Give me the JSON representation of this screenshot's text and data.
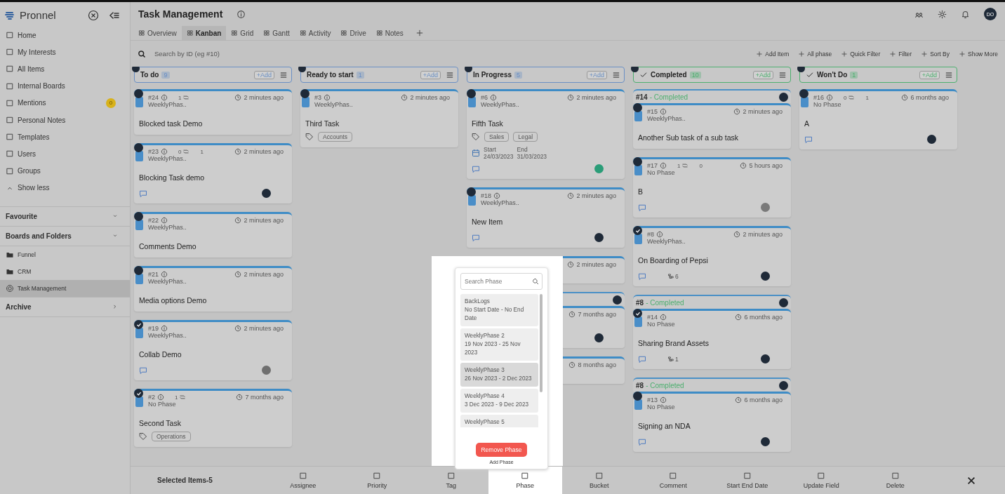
{
  "sidebar": {
    "brand": "Pronnel",
    "nav": [
      {
        "label": "Home"
      },
      {
        "label": "My Interests"
      },
      {
        "label": "All Items"
      },
      {
        "label": "Internal Boards"
      },
      {
        "label": "Mentions",
        "badge": "0"
      },
      {
        "label": "Personal Notes"
      },
      {
        "label": "Templates"
      },
      {
        "label": "Users"
      },
      {
        "label": "Groups"
      }
    ],
    "show_less": "Show less",
    "sections": [
      {
        "label": "Favourite",
        "expanded": true
      },
      {
        "label": "Boards and Folders",
        "expanded": true
      }
    ],
    "boards": [
      {
        "label": "Funnel",
        "kind": "folder",
        "selected": false
      },
      {
        "label": "CRM",
        "kind": "folder",
        "selected": false
      },
      {
        "label": "Task Management",
        "kind": "board",
        "selected": true
      }
    ],
    "archive": "Archive"
  },
  "header": {
    "title": "Task Management",
    "avatar": "DO"
  },
  "tabs": [
    {
      "label": "Overview",
      "selected": false
    },
    {
      "label": "Kanban",
      "selected": true
    },
    {
      "label": "Grid",
      "selected": false
    },
    {
      "label": "Gantt",
      "selected": false
    },
    {
      "label": "Activity",
      "selected": false
    },
    {
      "label": "Drive",
      "selected": false
    },
    {
      "label": "Notes",
      "selected": false
    }
  ],
  "search": {
    "placeholder": "Search by ID (eg #10)"
  },
  "toolbar": [
    "Add Item",
    "All phase",
    "Quick Filter",
    "Filter",
    "Sort By",
    "Show More"
  ],
  "columns": [
    {
      "title": "To do",
      "count": "9",
      "add": "+Add",
      "color": "#6a8fc4",
      "done": false,
      "items": [
        {
          "kind": "card",
          "checked": false,
          "id": "#24",
          "links": [
            "1"
          ],
          "time": "2 minutes ago",
          "phase": "WeeklyPhas..",
          "title": "Blocked task Demo",
          "comment_icon": false
        },
        {
          "kind": "card",
          "checked": false,
          "id": "#23",
          "links": [
            "0",
            "1"
          ],
          "time": "2 minutes ago",
          "phase": "WeeklyPhas..",
          "title": "Blocking Task demo",
          "comment_icon": true,
          "avatar": {
            "color": "#1f2a38"
          }
        },
        {
          "kind": "card",
          "checked": false,
          "id": "#22",
          "time": "2 minutes ago",
          "phase": "WeeklyPhas..",
          "title": "Comments Demo",
          "comment_icon": false
        },
        {
          "kind": "card",
          "checked": false,
          "id": "#21",
          "time": "2 minutes ago",
          "phase": "WeeklyPhas..",
          "title": "Media options Demo",
          "comment_icon": false
        },
        {
          "kind": "card",
          "checked": true,
          "id": "#19",
          "time": "2 minutes ago",
          "phase": "WeeklyPhas..",
          "title": "Collab Demo",
          "comment_icon": true,
          "avatar": {
            "color": "#6f6f6f"
          }
        },
        {
          "kind": "card",
          "checked": true,
          "id": "#2",
          "links": [
            "1"
          ],
          "time": "7 months ago",
          "phase": "No Phase",
          "title": "Second Task",
          "tags": [
            "Operations"
          ],
          "comment_icon": false
        }
      ]
    },
    {
      "title": "Ready to start",
      "count": "1",
      "add": "+Add",
      "color": "#6a8fc4",
      "done": false,
      "items": [
        {
          "kind": "card",
          "checked": false,
          "id": "#3",
          "time": "2 minutes ago",
          "phase": "WeeklyPhas..",
          "title": "Third Task",
          "tags": [
            "Accounts"
          ],
          "comment_icon": false
        }
      ]
    },
    {
      "title": "In Progress",
      "count": "5",
      "add": "+Add",
      "color": "#6a8fc4",
      "done": false,
      "items": [
        {
          "kind": "card",
          "checked": false,
          "id": "#6",
          "time": "2 minutes ago",
          "phase": "WeeklyPhas..",
          "title": "Fifth Task",
          "tags": [
            "Sales",
            "Legal"
          ],
          "dates": {
            "start_label": "Start",
            "start": "24/03/2023",
            "end_label": "End",
            "end": "31/03/2023"
          },
          "comment_icon": true,
          "avatar": {
            "color": "#2a9d78"
          }
        },
        {
          "kind": "card",
          "checked": false,
          "id": "#18",
          "time": "2 minutes ago",
          "phase": "WeeklyPhas..",
          "title": "New Item",
          "comment_icon": true,
          "avatar": {
            "color": "#1f2a38"
          }
        },
        {
          "kind": "card",
          "time": "2 minutes ago",
          "comment_icon": false
        },
        {
          "kind": "parent",
          "avatar": {
            "color": "#1f2a38"
          }
        },
        {
          "kind": "card",
          "time": "7 months ago",
          "comment_icon": false,
          "avatar": {
            "color": "#1f2a38"
          }
        },
        {
          "kind": "card",
          "time": "8 months ago",
          "comment_icon": false
        }
      ]
    },
    {
      "title": "Completed",
      "count": "10",
      "add": "+Add",
      "color": "#4caf6e",
      "done": true,
      "items": [
        {
          "kind": "parent",
          "id": "#14",
          "status": "- Completed",
          "avatar": {
            "color": "#1f2a38"
          }
        },
        {
          "kind": "card",
          "checked": false,
          "id": "#15",
          "time": "2 minutes ago",
          "phase": "WeeklyPhas..",
          "title": "Another Sub task of a sub task",
          "comment_icon": false
        },
        {
          "kind": "card",
          "checked": false,
          "id": "#17",
          "links": [
            "1",
            "0"
          ],
          "time": "5 hours ago",
          "phase": "No Phase",
          "title": "B",
          "comment_icon": true,
          "avatar": {
            "color": "#7a7a7a"
          }
        },
        {
          "kind": "card",
          "checked": true,
          "id": "#8",
          "time": "2 minutes ago",
          "phase": "WeeklyPhas..",
          "title": "On Boarding of Pepsi",
          "comment_icon": true,
          "subitems": "6",
          "avatar": {
            "color": "#1f2a38"
          }
        },
        {
          "kind": "parent",
          "id": "#8",
          "status": "- Completed",
          "avatar": {
            "color": "#1f2a38"
          }
        },
        {
          "kind": "card",
          "checked": true,
          "id": "#14",
          "time": "6 months ago",
          "phase": "No Phase",
          "title": "Sharing Brand Assets",
          "comment_icon": true,
          "subitems": "1",
          "avatar": {
            "color": "#1f2a38"
          }
        },
        {
          "kind": "parent",
          "id": "#8",
          "status": "- Completed",
          "avatar": {
            "color": "#1f2a38"
          }
        },
        {
          "kind": "card",
          "checked": false,
          "id": "#13",
          "time": "6 months ago",
          "phase": "No Phase",
          "title": "Signing an NDA",
          "comment_icon": true,
          "avatar": {
            "color": "#1f2a38"
          }
        }
      ]
    },
    {
      "title": "Won't Do",
      "count": "1",
      "add": "+Add",
      "color": "#4caf6e",
      "done": true,
      "items": [
        {
          "kind": "card",
          "checked": false,
          "id": "#16",
          "links": [
            "0",
            "1"
          ],
          "time": "6 months ago",
          "phase": "No Phase",
          "title": "A",
          "comment_icon": true,
          "avatar": {
            "color": "#1f2a38"
          }
        }
      ]
    }
  ],
  "phase_popover": {
    "placeholder": "Search Phase",
    "options": [
      {
        "name": "BackLogs",
        "range": "No Start Date - No End Date",
        "hovered": false
      },
      {
        "name": "WeeklyPhase 2",
        "range": "19 Nov 2023 - 25 Nov 2023",
        "hovered": false
      },
      {
        "name": "WeeklyPhase 3",
        "range": "26 Nov 2023 - 2 Dec 2023",
        "hovered": true
      },
      {
        "name": "WeeklyPhase 4",
        "range": "3 Dec 2023 - 9 Dec 2023",
        "hovered": false
      },
      {
        "name": "WeeklyPhase 5",
        "hovered": false
      }
    ],
    "remove": "Remove Phase",
    "add": "Add Phase"
  },
  "bulk_bar": {
    "selected": "Selected Items-5",
    "actions": [
      {
        "label": "Assignee",
        "selected": false
      },
      {
        "label": "Priority",
        "selected": false
      },
      {
        "label": "Tag",
        "selected": false
      },
      {
        "label": "Phase",
        "selected": true
      },
      {
        "label": "Bucket",
        "selected": false
      },
      {
        "label": "Comment",
        "selected": false
      },
      {
        "label": "Start End Date",
        "selected": false
      },
      {
        "label": "Update Field",
        "selected": false
      },
      {
        "label": "Delete",
        "selected": false
      }
    ]
  }
}
